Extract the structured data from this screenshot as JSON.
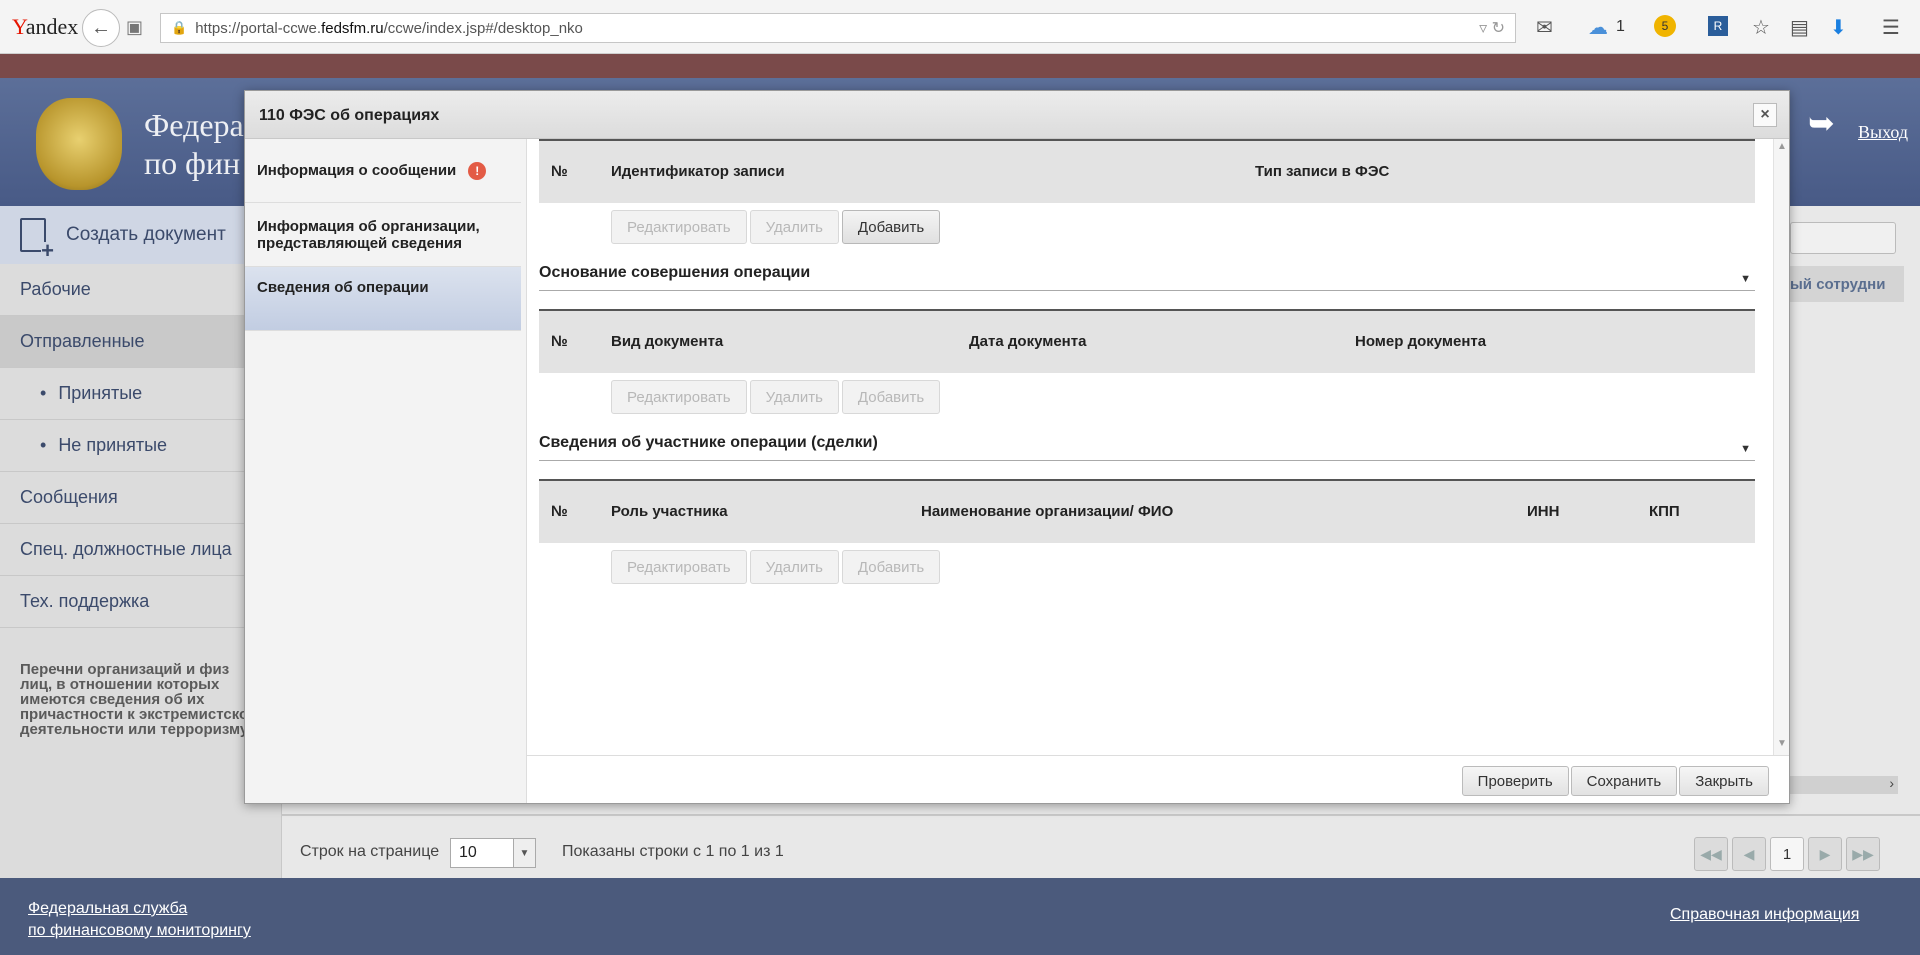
{
  "browser": {
    "logo": "Yandex",
    "url_prefix": "https://portal-ccwe.",
    "url_domain": "fedsfm.ru",
    "url_path": "/ccwe/index.jsp#/desktop_nko",
    "cloud_count": "1",
    "badge_count": "5"
  },
  "header": {
    "title_line1": "Федера",
    "title_line2": "по фин",
    "exit_label": "Выход"
  },
  "sidebar": {
    "create_doc": "Создать документ",
    "items": [
      {
        "label": "Рабочие"
      },
      {
        "label": "Отправленные"
      },
      {
        "label": "Принятые"
      },
      {
        "label": "Не принятые"
      },
      {
        "label": "Сообщения"
      },
      {
        "label": "Спец. должностные лица"
      },
      {
        "label": "Тех. поддержка"
      }
    ],
    "notice": "Перечни организаций и физ лиц, в отношении которых имеются сведения об их причастности к экстремистской деятельности или терроризму"
  },
  "main": {
    "col_head": "ый сотрудни",
    "rows_label": "Строк на странице",
    "rows_value": "10",
    "shown_label": "Показаны строки с 1 по 1 из 1",
    "page_number": "1"
  },
  "footer": {
    "left_line1": "Федеральная служба",
    "left_line2": "по финансовому мониторингу",
    "right": "Справочная информация"
  },
  "modal": {
    "title": "110 ФЭС об операциях",
    "close": "×",
    "nav": [
      {
        "label": "Информация о сообщении",
        "warning": "!"
      },
      {
        "label": "Информация об организации, представляющей сведения"
      },
      {
        "label": "Сведения об операции"
      }
    ],
    "table1": {
      "headers": [
        "№",
        "Идентификатор записи",
        "Тип записи в ФЭС"
      ]
    },
    "section2": "Основание совершения операции",
    "table2": {
      "headers": [
        "№",
        "Вид документа",
        "Дата документа",
        "Номер документа"
      ]
    },
    "section3": "Сведения об участнике операции (сделки)",
    "table3": {
      "headers": [
        "№",
        "Роль участника",
        "Наименование организации/ ФИО",
        "ИНН",
        "КПП"
      ]
    },
    "buttons": {
      "edit": "Редактировать",
      "delete": "Удалить",
      "add": "Добавить"
    },
    "footer_buttons": {
      "check": "Проверить",
      "save": "Сохранить",
      "close": "Закрыть"
    }
  }
}
